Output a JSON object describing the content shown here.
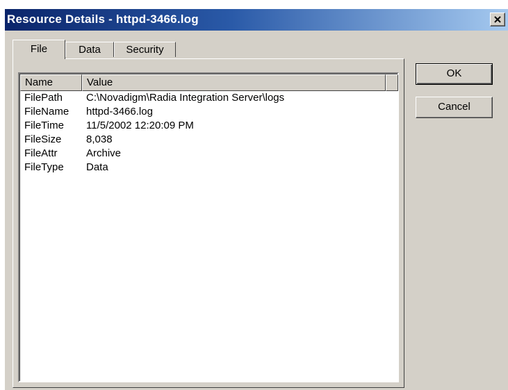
{
  "window": {
    "title": "Resource Details - httpd-3466.log"
  },
  "tabs": [
    {
      "label": "File",
      "active": true
    },
    {
      "label": "Data",
      "active": false
    },
    {
      "label": "Security",
      "active": false
    }
  ],
  "list": {
    "columns": [
      "Name",
      "Value"
    ],
    "rows": [
      {
        "name": "FilePath",
        "value": "C:\\Novadigm\\Radia Integration Server\\logs"
      },
      {
        "name": "FileName",
        "value": "httpd-3466.log"
      },
      {
        "name": "FileTime",
        "value": "11/5/2002 12:20:09 PM"
      },
      {
        "name": "FileSize",
        "value": "8,038"
      },
      {
        "name": "FileAttr",
        "value": "Archive"
      },
      {
        "name": "FileType",
        "value": "Data"
      }
    ]
  },
  "buttons": {
    "ok": "OK",
    "cancel": "Cancel"
  },
  "colors": {
    "title_gradient_start": "#0a246a",
    "title_gradient_end": "#a6caf0",
    "face": "#d4d0c8"
  },
  "icons": {
    "close": "close-icon"
  }
}
